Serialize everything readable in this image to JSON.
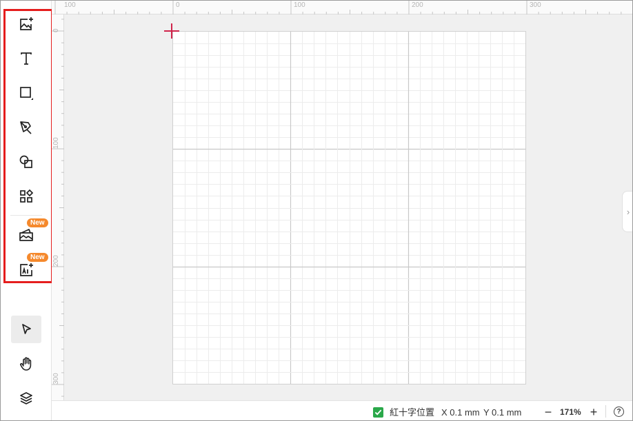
{
  "toolbar": {
    "tools": [
      {
        "name": "image-tool",
        "icon": "image-add-icon"
      },
      {
        "name": "text-tool",
        "icon": "text-T-icon"
      },
      {
        "name": "rectangle-tool",
        "icon": "rectangle-icon"
      },
      {
        "name": "pen-tool",
        "icon": "pen-nib-icon"
      },
      {
        "name": "shapes-tool",
        "icon": "shapes-icon"
      },
      {
        "name": "elements-tool",
        "icon": "elements-grid-icon"
      },
      {
        "name": "material-tool",
        "icon": "folder-image-icon",
        "badge": "New"
      },
      {
        "name": "ai-image-tool",
        "icon": "ai-image-icon",
        "badge": "New"
      }
    ],
    "bottom_tools": [
      {
        "name": "select-tool",
        "icon": "cursor-arrow-icon",
        "active": true
      },
      {
        "name": "hand-tool",
        "icon": "hand-pan-icon"
      },
      {
        "name": "layers-tool",
        "icon": "layers-icon"
      }
    ]
  },
  "rulers": {
    "top_labels": [
      "100",
      "0",
      "100",
      "200",
      "300"
    ],
    "left_labels": [
      "0",
      "100",
      "200",
      "300"
    ]
  },
  "status": {
    "checkbox_checked": true,
    "crosshair_label": "紅十字位置",
    "x_readout": "X 0.1 mm",
    "y_readout": "Y 0.1 mm",
    "zoom": "171%",
    "zoom_out": "−",
    "zoom_in": "+",
    "help": "?"
  },
  "colors": {
    "highlight": "#e51d1d",
    "badge": "#f5892c",
    "checkbox": "#2aa84a",
    "crosshair": "#d0234a"
  }
}
